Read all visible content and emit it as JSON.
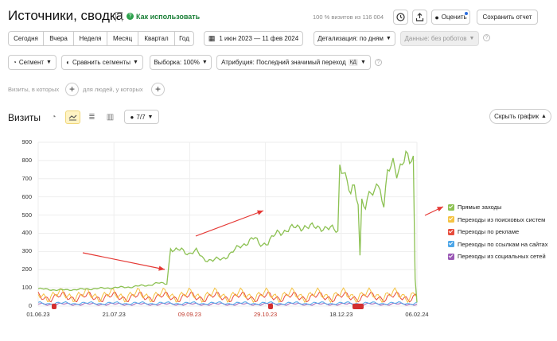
{
  "header": {
    "title": "Источники, сводка",
    "how_to_use": "Как использовать",
    "visits_share": "100 % визитов из 116 004",
    "rate_label": "Оценить",
    "save_report_label": "Сохранить отчет"
  },
  "period_tabs": [
    "Сегодня",
    "Вчера",
    "Неделя",
    "Месяц",
    "Квартал",
    "Год"
  ],
  "date_range": "1 июн 2023 — 11 фев 2024",
  "detail_label": "Детализация: по дням",
  "data_label": "Данные: без роботов",
  "filters": {
    "segment": "Сегмент",
    "compare": "Сравнить сегменты",
    "sample": "Выборка: 100%",
    "attribution": "Атрибуция: Последний значимый переход",
    "attribution_badge": "КД"
  },
  "segment_builder": {
    "visits_hint": "Визиты, в которых",
    "people_hint": "для людей, у которых"
  },
  "chart_toolbar": {
    "title": "Визиты",
    "metrics_count": "7/7",
    "hide_chart": "Скрыть график"
  },
  "colors": {
    "direct": "#8cc152",
    "search": "#f5c342",
    "ads": "#e74c3c",
    "links": "#4da6e8",
    "social": "#9b59b6",
    "arrow": "#e53935"
  },
  "chart_data": {
    "type": "line",
    "ylim": [
      0,
      900
    ],
    "yticks": [
      "0",
      "100",
      "200",
      "300",
      "400",
      "500",
      "600",
      "700",
      "800",
      "900"
    ],
    "xticks": [
      {
        "label": "01.06.23",
        "red": false
      },
      {
        "label": "21.07.23",
        "red": false
      },
      {
        "label": "09.09.23",
        "red": true
      },
      {
        "label": "29.10.23",
        "red": true
      },
      {
        "label": "18.12.23",
        "red": false
      },
      {
        "label": "06.02.24",
        "red": false
      }
    ],
    "series": [
      {
        "name": "Прямые заходы",
        "color": "#8cc152",
        "points": [
          [
            0,
            95
          ],
          [
            10,
            88
          ],
          [
            20,
            90
          ],
          [
            30,
            95
          ],
          [
            40,
            100
          ],
          [
            50,
            105
          ],
          [
            55,
            110
          ],
          [
            60,
            115
          ],
          [
            65,
            125
          ],
          [
            70,
            125
          ],
          [
            72,
            320
          ],
          [
            74,
            300
          ],
          [
            78,
            310
          ],
          [
            82,
            290
          ],
          [
            86,
            300
          ],
          [
            90,
            260
          ],
          [
            95,
            250
          ],
          [
            100,
            260
          ],
          [
            105,
            290
          ],
          [
            110,
            330
          ],
          [
            115,
            360
          ],
          [
            118,
            370
          ],
          [
            120,
            340
          ],
          [
            125,
            350
          ],
          [
            130,
            400
          ],
          [
            135,
            420
          ],
          [
            140,
            430
          ],
          [
            145,
            440
          ],
          [
            150,
            430
          ],
          [
            155,
            435
          ],
          [
            160,
            420
          ],
          [
            163,
            410
          ],
          [
            164,
            780
          ],
          [
            166,
            760
          ],
          [
            168,
            680
          ],
          [
            170,
            600
          ],
          [
            172,
            660
          ],
          [
            174,
            560
          ],
          [
            175,
            280
          ],
          [
            176,
            620
          ],
          [
            178,
            520
          ],
          [
            180,
            630
          ],
          [
            182,
            580
          ],
          [
            184,
            700
          ],
          [
            186,
            640
          ],
          [
            188,
            560
          ],
          [
            190,
            720
          ],
          [
            193,
            780
          ],
          [
            195,
            740
          ],
          [
            198,
            800
          ],
          [
            200,
            820
          ],
          [
            202,
            780
          ],
          [
            204,
            800
          ],
          [
            205,
            150
          ],
          [
            206,
            20
          ]
        ]
      },
      {
        "name": "Переходы из поисковых систем",
        "color": "#f5c342",
        "base": 60,
        "amp": 40
      },
      {
        "name": "Переходы по рекламе",
        "color": "#e74c3c",
        "base": 50,
        "amp": 30
      },
      {
        "name": "Переходы по ссылкам на сайтах",
        "color": "#4da6e8",
        "base": 15,
        "amp": 10
      },
      {
        "name": "Переходы из социальных сетей",
        "color": "#9b59b6",
        "base": 10,
        "amp": 8
      }
    ],
    "legend_position": "right"
  }
}
